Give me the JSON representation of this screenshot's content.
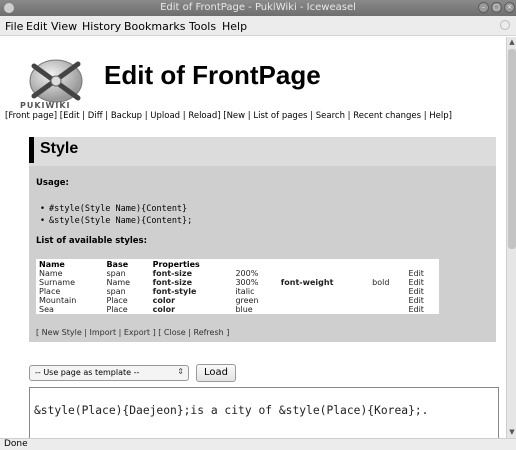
{
  "window": {
    "title": "Edit of FrontPage - PukiWiki - Iceweasel"
  },
  "menubar": {
    "items": [
      "File",
      "Edit",
      "View",
      "History",
      "Bookmarks",
      "Tools",
      "Help"
    ]
  },
  "header": {
    "logo_text": "PUKIWIKI",
    "page_title": "Edit of FrontPage",
    "nav_text": "[Front page]  [Edit | Diff | Backup | Upload | Reload]  [New | List of pages | Search | Recent changes | Help]"
  },
  "style_panel": {
    "title": "Style",
    "usage_label": "Usage:",
    "usage_lines": [
      "#style(Style Name){Content}",
      "&style(Style Name){Content};"
    ],
    "list_label": "List of available styles:",
    "columns": [
      "Name",
      "Base",
      "Properties"
    ],
    "rows": [
      {
        "name": "Name",
        "base": "span",
        "prop1": "font-size",
        "val1": "200%",
        "prop2": "",
        "val2": "",
        "action": "Edit"
      },
      {
        "name": "Surname",
        "base": "Name",
        "prop1": "font-size",
        "val1": "300%",
        "prop2": "font-weight",
        "val2": "bold",
        "action": "Edit"
      },
      {
        "name": "Place",
        "base": "span",
        "prop1": "font-style",
        "val1": "italic",
        "prop2": "",
        "val2": "",
        "action": "Edit"
      },
      {
        "name": "Mountain",
        "base": "Place",
        "prop1": "color",
        "val1": "green",
        "prop2": "",
        "val2": "",
        "action": "Edit"
      },
      {
        "name": "Sea",
        "base": "Place",
        "prop1": "color",
        "val1": "blue",
        "prop2": "",
        "val2": "",
        "action": "Edit"
      }
    ],
    "footer_nav": "[ New Style | Import | Export ] [ Close | Refresh ]"
  },
  "template": {
    "selected": "-- Use page as template --",
    "load_label": "Load"
  },
  "editor": {
    "content": "&style(Place){Daejeon};is a city of &style(Place){Korea};."
  },
  "statusbar": {
    "text": "Done"
  }
}
